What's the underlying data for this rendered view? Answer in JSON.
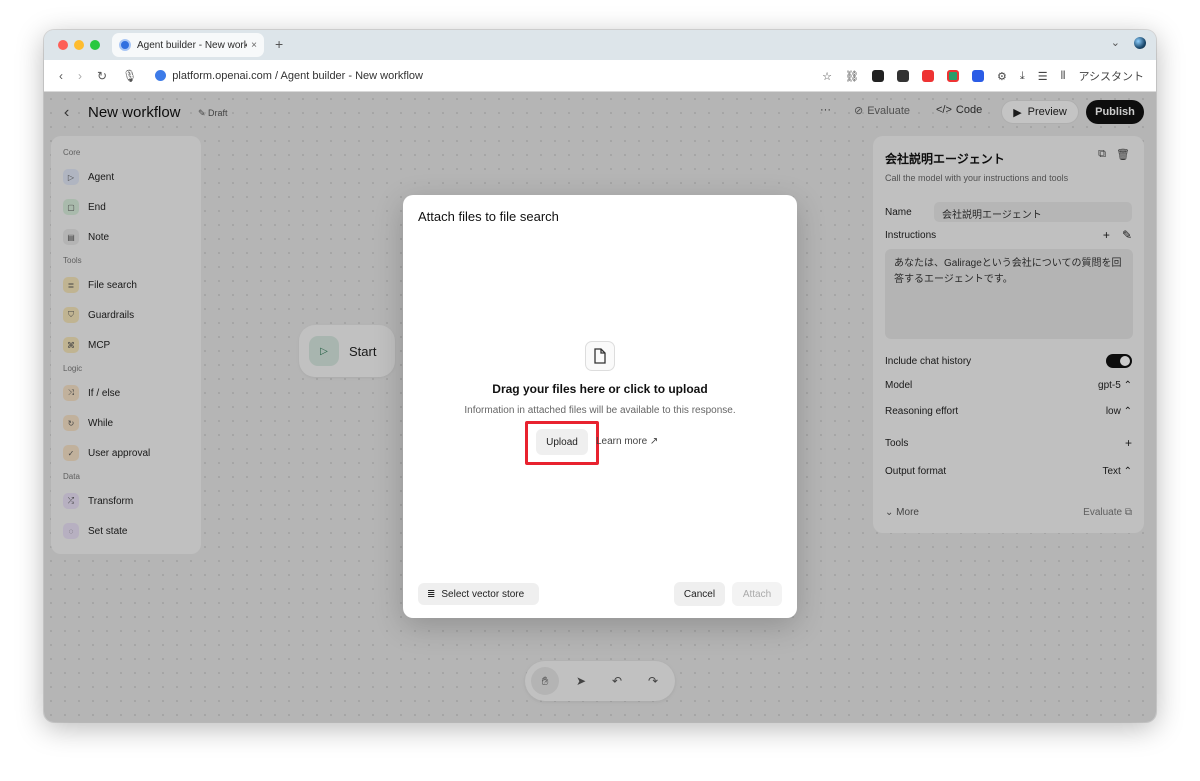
{
  "browser": {
    "tab_title": "Agent builder - New workflo",
    "new_tab": "+",
    "url": "platform.openai.com / Agent builder - New workflow",
    "assistant_label": "アシスタント"
  },
  "header": {
    "back": "‹",
    "title": "New workflow",
    "draft": "Draft",
    "more": "···",
    "evaluate": "Evaluate",
    "code": "Code",
    "preview": "Preview",
    "publish": "Publish"
  },
  "palette": {
    "sections": [
      {
        "title": "Core",
        "items": [
          {
            "label": "Agent",
            "icon": "agent-icon",
            "color": "#dde4f3"
          },
          {
            "label": "End",
            "icon": "end-icon",
            "color": "#d5ead8"
          },
          {
            "label": "Note",
            "icon": "note-icon",
            "color": "#e3e3e3"
          }
        ]
      },
      {
        "title": "Tools",
        "items": [
          {
            "label": "File search",
            "icon": "database-icon",
            "color": "#f2e2b8"
          },
          {
            "label": "Guardrails",
            "icon": "shield-icon",
            "color": "#f2e2b8"
          },
          {
            "label": "MCP",
            "icon": "mcp-icon",
            "color": "#f2e2b8"
          }
        ]
      },
      {
        "title": "Logic",
        "items": [
          {
            "label": "If / else",
            "icon": "branch-icon",
            "color": "#f3dfc4"
          },
          {
            "label": "While",
            "icon": "loop-icon",
            "color": "#f3dfc4"
          },
          {
            "label": "User approval",
            "icon": "approval-icon",
            "color": "#f3dfc4"
          }
        ]
      },
      {
        "title": "Data",
        "items": [
          {
            "label": "Transform",
            "icon": "transform-icon",
            "color": "#e6ddf3"
          },
          {
            "label": "Set state",
            "icon": "state-icon",
            "color": "#e6ddf3"
          }
        ]
      }
    ]
  },
  "start_node": {
    "label": "Start"
  },
  "inspector": {
    "title": "会社説明エージェント",
    "subtitle": "Call the model with your instructions and tools",
    "name_label": "Name",
    "name_value": "会社説明エージェント",
    "instructions_label": "Instructions",
    "instructions_value": "あなたは、Galirageという会社についての質問を回答するエージェントです。",
    "chat_history_label": "Include chat history",
    "model_label": "Model",
    "model_value": "gpt-5",
    "reasoning_label": "Reasoning effort",
    "reasoning_value": "low",
    "tools_label": "Tools",
    "output_label": "Output format",
    "output_value": "Text",
    "more_label": "More",
    "evaluate_label": "Evaluate"
  },
  "modal": {
    "title": "Attach files to file search",
    "drop_heading": "Drag your files here or click to upload",
    "drop_sub": "Information in attached files will be available to this response.",
    "upload": "Upload",
    "learn_more": "Learn more ↗",
    "select_vector_store": "Select vector store",
    "cancel": "Cancel",
    "attach": "Attach"
  },
  "colors": {
    "highlight": "#e8222f",
    "publish_bg": "#111111"
  }
}
